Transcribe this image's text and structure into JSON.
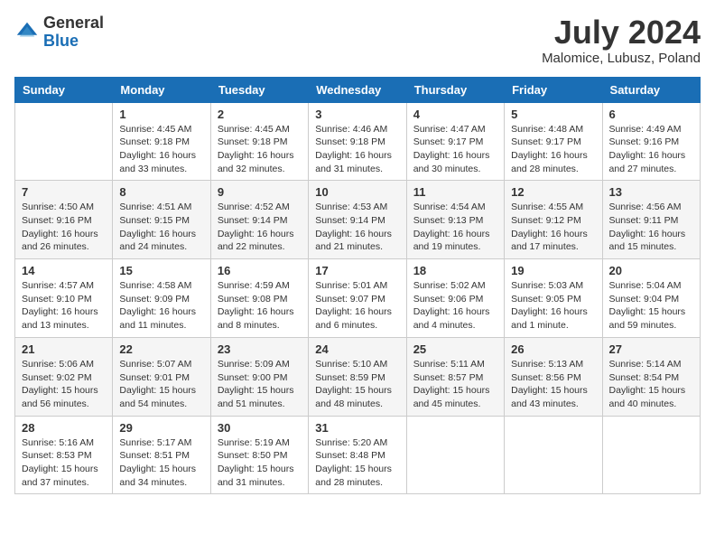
{
  "header": {
    "logo_general": "General",
    "logo_blue": "Blue",
    "month": "July 2024",
    "location": "Malomice, Lubusz, Poland"
  },
  "weekdays": [
    "Sunday",
    "Monday",
    "Tuesday",
    "Wednesday",
    "Thursday",
    "Friday",
    "Saturday"
  ],
  "weeks": [
    [
      {
        "day": "",
        "sunrise": "",
        "sunset": "",
        "daylight": ""
      },
      {
        "day": "1",
        "sunrise": "Sunrise: 4:45 AM",
        "sunset": "Sunset: 9:18 PM",
        "daylight": "Daylight: 16 hours and 33 minutes."
      },
      {
        "day": "2",
        "sunrise": "Sunrise: 4:45 AM",
        "sunset": "Sunset: 9:18 PM",
        "daylight": "Daylight: 16 hours and 32 minutes."
      },
      {
        "day": "3",
        "sunrise": "Sunrise: 4:46 AM",
        "sunset": "Sunset: 9:18 PM",
        "daylight": "Daylight: 16 hours and 31 minutes."
      },
      {
        "day": "4",
        "sunrise": "Sunrise: 4:47 AM",
        "sunset": "Sunset: 9:17 PM",
        "daylight": "Daylight: 16 hours and 30 minutes."
      },
      {
        "day": "5",
        "sunrise": "Sunrise: 4:48 AM",
        "sunset": "Sunset: 9:17 PM",
        "daylight": "Daylight: 16 hours and 28 minutes."
      },
      {
        "day": "6",
        "sunrise": "Sunrise: 4:49 AM",
        "sunset": "Sunset: 9:16 PM",
        "daylight": "Daylight: 16 hours and 27 minutes."
      }
    ],
    [
      {
        "day": "7",
        "sunrise": "Sunrise: 4:50 AM",
        "sunset": "Sunset: 9:16 PM",
        "daylight": "Daylight: 16 hours and 26 minutes."
      },
      {
        "day": "8",
        "sunrise": "Sunrise: 4:51 AM",
        "sunset": "Sunset: 9:15 PM",
        "daylight": "Daylight: 16 hours and 24 minutes."
      },
      {
        "day": "9",
        "sunrise": "Sunrise: 4:52 AM",
        "sunset": "Sunset: 9:14 PM",
        "daylight": "Daylight: 16 hours and 22 minutes."
      },
      {
        "day": "10",
        "sunrise": "Sunrise: 4:53 AM",
        "sunset": "Sunset: 9:14 PM",
        "daylight": "Daylight: 16 hours and 21 minutes."
      },
      {
        "day": "11",
        "sunrise": "Sunrise: 4:54 AM",
        "sunset": "Sunset: 9:13 PM",
        "daylight": "Daylight: 16 hours and 19 minutes."
      },
      {
        "day": "12",
        "sunrise": "Sunrise: 4:55 AM",
        "sunset": "Sunset: 9:12 PM",
        "daylight": "Daylight: 16 hours and 17 minutes."
      },
      {
        "day": "13",
        "sunrise": "Sunrise: 4:56 AM",
        "sunset": "Sunset: 9:11 PM",
        "daylight": "Daylight: 16 hours and 15 minutes."
      }
    ],
    [
      {
        "day": "14",
        "sunrise": "Sunrise: 4:57 AM",
        "sunset": "Sunset: 9:10 PM",
        "daylight": "Daylight: 16 hours and 13 minutes."
      },
      {
        "day": "15",
        "sunrise": "Sunrise: 4:58 AM",
        "sunset": "Sunset: 9:09 PM",
        "daylight": "Daylight: 16 hours and 11 minutes."
      },
      {
        "day": "16",
        "sunrise": "Sunrise: 4:59 AM",
        "sunset": "Sunset: 9:08 PM",
        "daylight": "Daylight: 16 hours and 8 minutes."
      },
      {
        "day": "17",
        "sunrise": "Sunrise: 5:01 AM",
        "sunset": "Sunset: 9:07 PM",
        "daylight": "Daylight: 16 hours and 6 minutes."
      },
      {
        "day": "18",
        "sunrise": "Sunrise: 5:02 AM",
        "sunset": "Sunset: 9:06 PM",
        "daylight": "Daylight: 16 hours and 4 minutes."
      },
      {
        "day": "19",
        "sunrise": "Sunrise: 5:03 AM",
        "sunset": "Sunset: 9:05 PM",
        "daylight": "Daylight: 16 hours and 1 minute."
      },
      {
        "day": "20",
        "sunrise": "Sunrise: 5:04 AM",
        "sunset": "Sunset: 9:04 PM",
        "daylight": "Daylight: 15 hours and 59 minutes."
      }
    ],
    [
      {
        "day": "21",
        "sunrise": "Sunrise: 5:06 AM",
        "sunset": "Sunset: 9:02 PM",
        "daylight": "Daylight: 15 hours and 56 minutes."
      },
      {
        "day": "22",
        "sunrise": "Sunrise: 5:07 AM",
        "sunset": "Sunset: 9:01 PM",
        "daylight": "Daylight: 15 hours and 54 minutes."
      },
      {
        "day": "23",
        "sunrise": "Sunrise: 5:09 AM",
        "sunset": "Sunset: 9:00 PM",
        "daylight": "Daylight: 15 hours and 51 minutes."
      },
      {
        "day": "24",
        "sunrise": "Sunrise: 5:10 AM",
        "sunset": "Sunset: 8:59 PM",
        "daylight": "Daylight: 15 hours and 48 minutes."
      },
      {
        "day": "25",
        "sunrise": "Sunrise: 5:11 AM",
        "sunset": "Sunset: 8:57 PM",
        "daylight": "Daylight: 15 hours and 45 minutes."
      },
      {
        "day": "26",
        "sunrise": "Sunrise: 5:13 AM",
        "sunset": "Sunset: 8:56 PM",
        "daylight": "Daylight: 15 hours and 43 minutes."
      },
      {
        "day": "27",
        "sunrise": "Sunrise: 5:14 AM",
        "sunset": "Sunset: 8:54 PM",
        "daylight": "Daylight: 15 hours and 40 minutes."
      }
    ],
    [
      {
        "day": "28",
        "sunrise": "Sunrise: 5:16 AM",
        "sunset": "Sunset: 8:53 PM",
        "daylight": "Daylight: 15 hours and 37 minutes."
      },
      {
        "day": "29",
        "sunrise": "Sunrise: 5:17 AM",
        "sunset": "Sunset: 8:51 PM",
        "daylight": "Daylight: 15 hours and 34 minutes."
      },
      {
        "day": "30",
        "sunrise": "Sunrise: 5:19 AM",
        "sunset": "Sunset: 8:50 PM",
        "daylight": "Daylight: 15 hours and 31 minutes."
      },
      {
        "day": "31",
        "sunrise": "Sunrise: 5:20 AM",
        "sunset": "Sunset: 8:48 PM",
        "daylight": "Daylight: 15 hours and 28 minutes."
      },
      {
        "day": "",
        "sunrise": "",
        "sunset": "",
        "daylight": ""
      },
      {
        "day": "",
        "sunrise": "",
        "sunset": "",
        "daylight": ""
      },
      {
        "day": "",
        "sunrise": "",
        "sunset": "",
        "daylight": ""
      }
    ]
  ]
}
